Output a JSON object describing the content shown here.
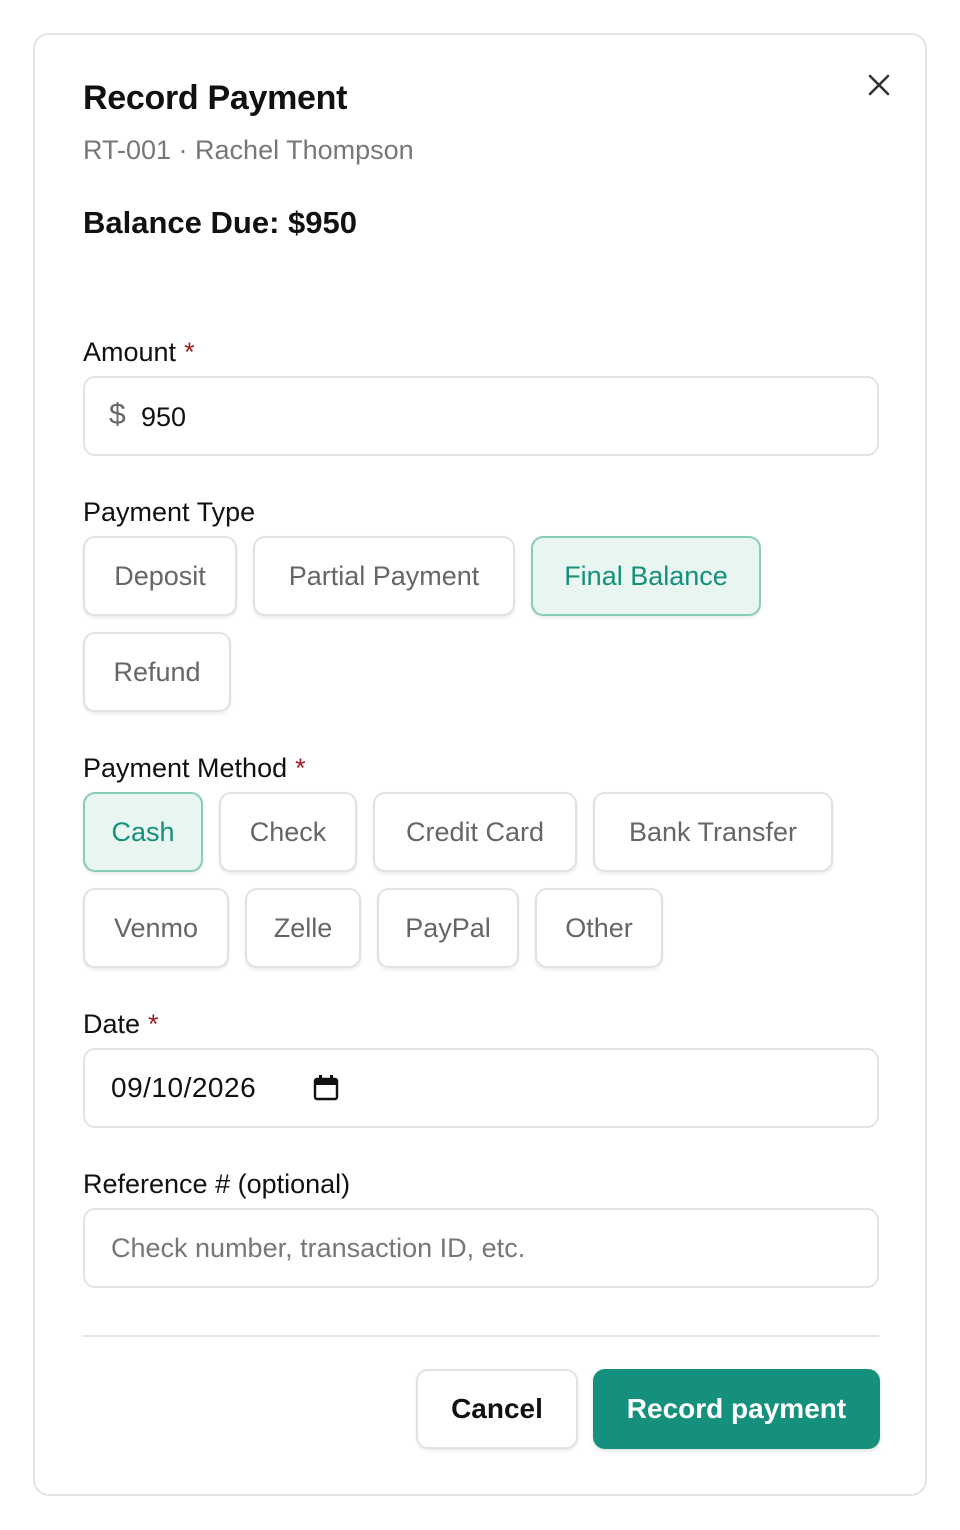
{
  "dialog": {
    "title": "Record Payment",
    "subtitle": "RT-001 · Rachel Thompson",
    "balance": "Balance Due: $950",
    "close_icon": "close-icon"
  },
  "amount": {
    "label": "Amount",
    "required_mark": "*",
    "currency_symbol": "$",
    "value": "950"
  },
  "payment_type": {
    "label": "Payment Type",
    "options": [
      "Deposit",
      "Partial Payment",
      "Final Balance",
      "Refund"
    ],
    "selected": "Final Balance"
  },
  "payment_method": {
    "label": "Payment Method",
    "required_mark": "*",
    "options": [
      "Cash",
      "Check",
      "Credit Card",
      "Bank Transfer",
      "Venmo",
      "Zelle",
      "PayPal",
      "Other"
    ],
    "selected": "Cash"
  },
  "date": {
    "label": "Date",
    "required_mark": "*",
    "value": "09/10/2026",
    "icon": "calendar-icon"
  },
  "reference": {
    "label": "Reference # (optional)",
    "placeholder": "Check number, transaction ID, etc."
  },
  "actions": {
    "cancel_label": "Cancel",
    "submit_label": "Record payment"
  },
  "colors": {
    "accent": "#14907c",
    "selected_bg": "#e9f5f1",
    "required": "#9b2222"
  }
}
